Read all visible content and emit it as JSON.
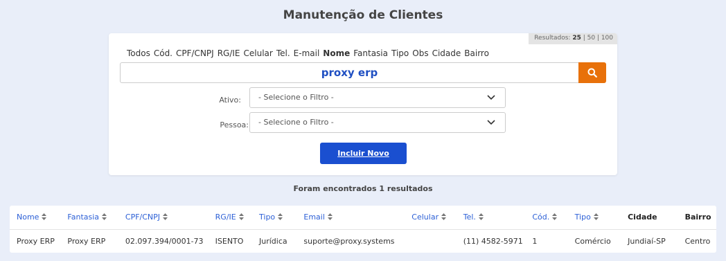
{
  "page": {
    "title": "Manutenção de Clientes"
  },
  "pagination": {
    "prefix": "Resultados:",
    "selected": "25",
    "rest": " | 50 | 100"
  },
  "filter_tabs": [
    {
      "label": "Todos",
      "active": false
    },
    {
      "label": "Cód.",
      "active": false
    },
    {
      "label": "CPF/CNPJ",
      "active": false
    },
    {
      "label": "RG/IE",
      "active": false
    },
    {
      "label": "Celular",
      "active": false
    },
    {
      "label": "Tel.",
      "active": false
    },
    {
      "label": "E-mail",
      "active": false
    },
    {
      "label": "Nome",
      "active": true
    },
    {
      "label": "Fantasia",
      "active": false
    },
    {
      "label": "Tipo",
      "active": false
    },
    {
      "label": "Obs",
      "active": false
    },
    {
      "label": "Cidade",
      "active": false
    },
    {
      "label": "Bairro",
      "active": false
    }
  ],
  "search": {
    "value": "proxy erp",
    "button_icon": "search-icon"
  },
  "filters": {
    "ativo": {
      "label": "Ativo:",
      "value": "- Selecione o Filtro -"
    },
    "pessoa": {
      "label": "Pessoa:",
      "value": "- Selecione o Filtro -"
    }
  },
  "actions": {
    "new_label": "Incluir Novo"
  },
  "results": {
    "prefix": "Foram encontrados ",
    "count": "1",
    "suffix": " resultados"
  },
  "table": {
    "columns": [
      {
        "label": "Nome",
        "sortable": true
      },
      {
        "label": "Fantasia",
        "sortable": true
      },
      {
        "label": "CPF/CNPJ",
        "sortable": true
      },
      {
        "label": "RG/IE",
        "sortable": true
      },
      {
        "label": "Tipo",
        "sortable": true
      },
      {
        "label": "Email",
        "sortable": true
      },
      {
        "label": "Celular",
        "sortable": true
      },
      {
        "label": "Tel.",
        "sortable": true
      },
      {
        "label": "Cód.",
        "sortable": true
      },
      {
        "label": "Tipo",
        "sortable": true
      },
      {
        "label": "Cidade",
        "sortable": false
      },
      {
        "label": "Bairro",
        "sortable": false
      }
    ],
    "rows": [
      [
        "Proxy ERP",
        "Proxy ERP",
        "02.097.394/0001-73",
        "ISENTO",
        "Jurídica",
        "suporte@proxy.systems",
        "",
        "(11) 4582-5971",
        "1",
        "Comércio",
        "Jundiaí-SP",
        "Centro"
      ]
    ]
  },
  "colors": {
    "accent": "#1a4fd0",
    "search_button": "#e8710a",
    "link": "#2b5fd6",
    "background": "#e9eef9"
  }
}
